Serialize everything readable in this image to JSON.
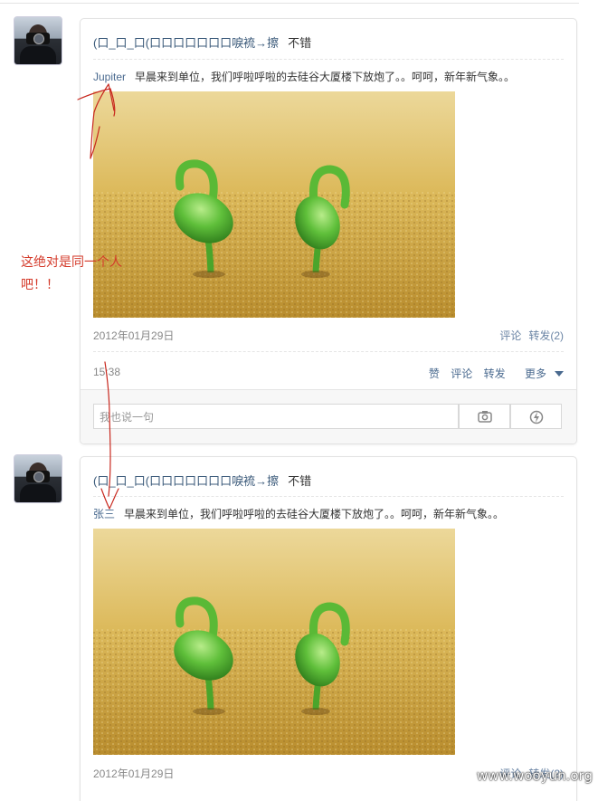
{
  "posts": [
    {
      "title_name": "(\u0000_\u0000_\u0000(\u0000\u0000\u0000\u0000\u0000\u0000\u0000\u0000\u0000\u0000\u0000\u0000\u0000\u0000",
      "title_display": "(口_口_口(口口口口口口口唳裗→擦",
      "comment": "不错",
      "orig_author": "Jupiter",
      "orig_text": "早晨来到单位，我们呼啦呼啦的去硅谷大厦楼下放炮了。。呵呵，新年新气象。。",
      "date": "2012年01月29日",
      "orig_comment_label": "评论",
      "orig_forward_label": "转发(2)",
      "time": "15:38",
      "like_label": "赞",
      "comment_label": "评论",
      "forward_label": "转发",
      "more_label": "更多",
      "comment_placeholder": "我也说一句"
    },
    {
      "title_display": "(口_口_口(口口口口口口口唳裗→擦",
      "comment": "不错",
      "orig_author": "张三",
      "orig_text": "早晨来到单位，我们呼啦呼啦的去硅谷大厦楼下放炮了。。呵呵，新年新气象。。",
      "date": "2012年01月29日",
      "orig_comment_label": "评论",
      "orig_forward_label": "转发(2)"
    }
  ],
  "annotation": {
    "line1": "这绝对是同一个人",
    "line2": "吧！！",
    "color": "#d43a2a"
  },
  "watermark": "www.wooyun.org",
  "icons": {
    "camera": "camera-icon",
    "emoji": "lightning-face-icon",
    "more_arrow": "caret-down-icon"
  }
}
